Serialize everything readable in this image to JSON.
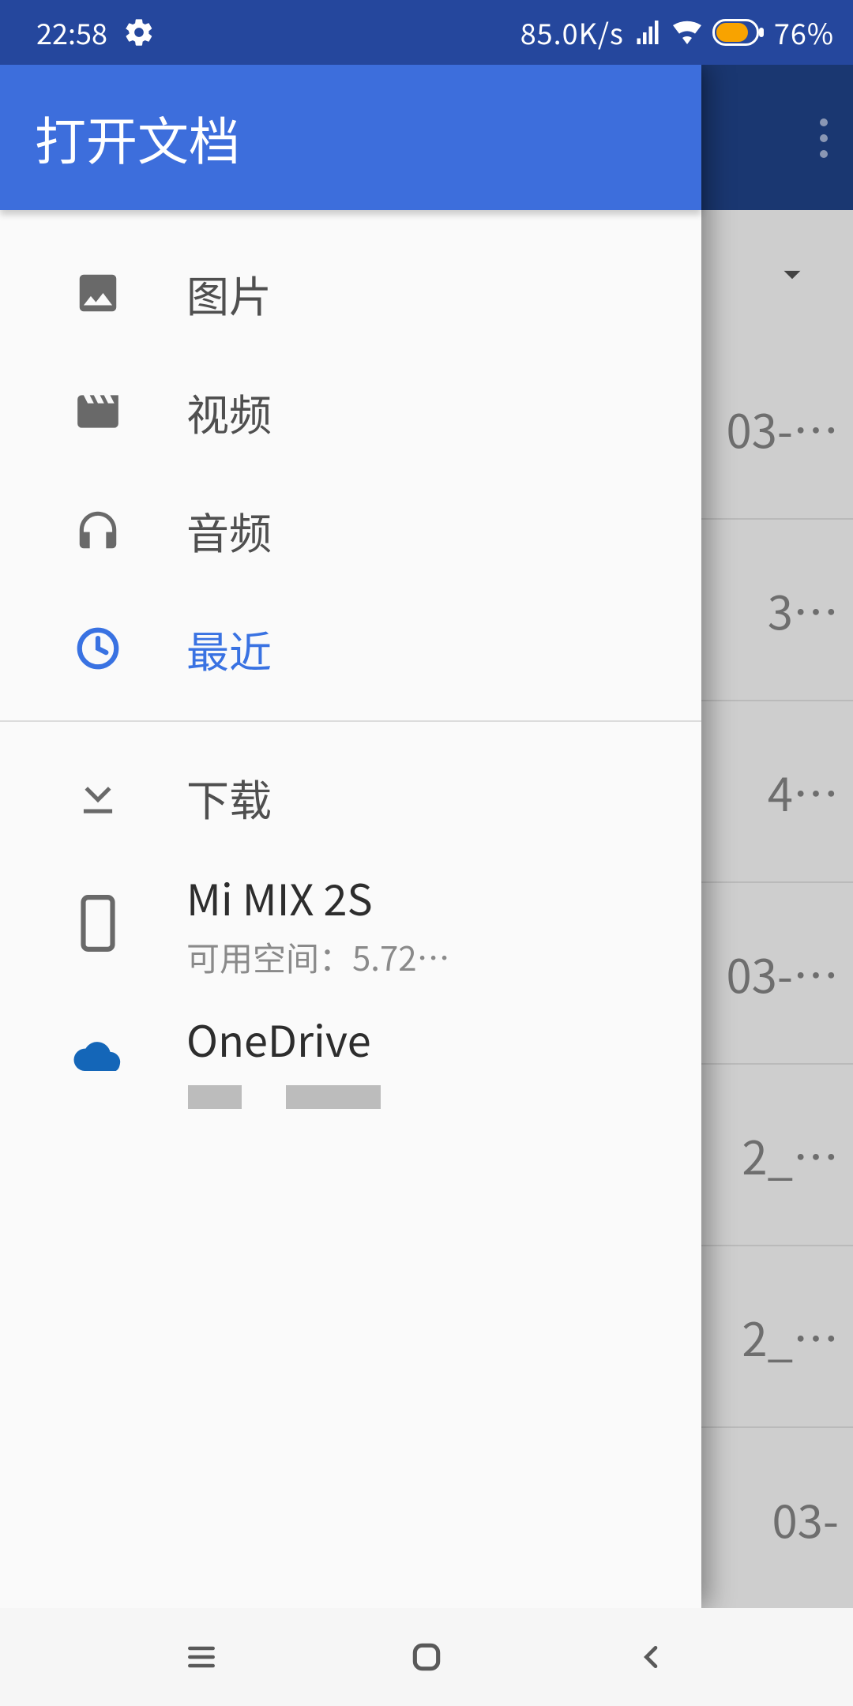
{
  "status": {
    "time": "22:58",
    "speed": "85.0K/s",
    "battery_pct": "76%"
  },
  "drawer": {
    "title": "打开文档",
    "categories": [
      {
        "icon": "image",
        "label": "图片"
      },
      {
        "icon": "video",
        "label": "视频"
      },
      {
        "icon": "audio",
        "label": "音频"
      },
      {
        "icon": "recent",
        "label": "最近",
        "active": true
      }
    ],
    "locations": [
      {
        "icon": "download",
        "label": "下载"
      },
      {
        "icon": "phone",
        "label": "Mi MIX 2S",
        "sub": "可用空间：5.72…"
      },
      {
        "icon": "onedrive",
        "label": "OneDrive",
        "sub": ""
      }
    ]
  },
  "background": {
    "list_fragments": [
      "03-…",
      "3…",
      "4…",
      "03-…",
      "2_…",
      "2_…",
      "03-"
    ]
  },
  "icons": {
    "gear": "gear-icon",
    "signal": "signal-icon",
    "wifi": "wifi-icon",
    "battery": "battery-icon"
  }
}
